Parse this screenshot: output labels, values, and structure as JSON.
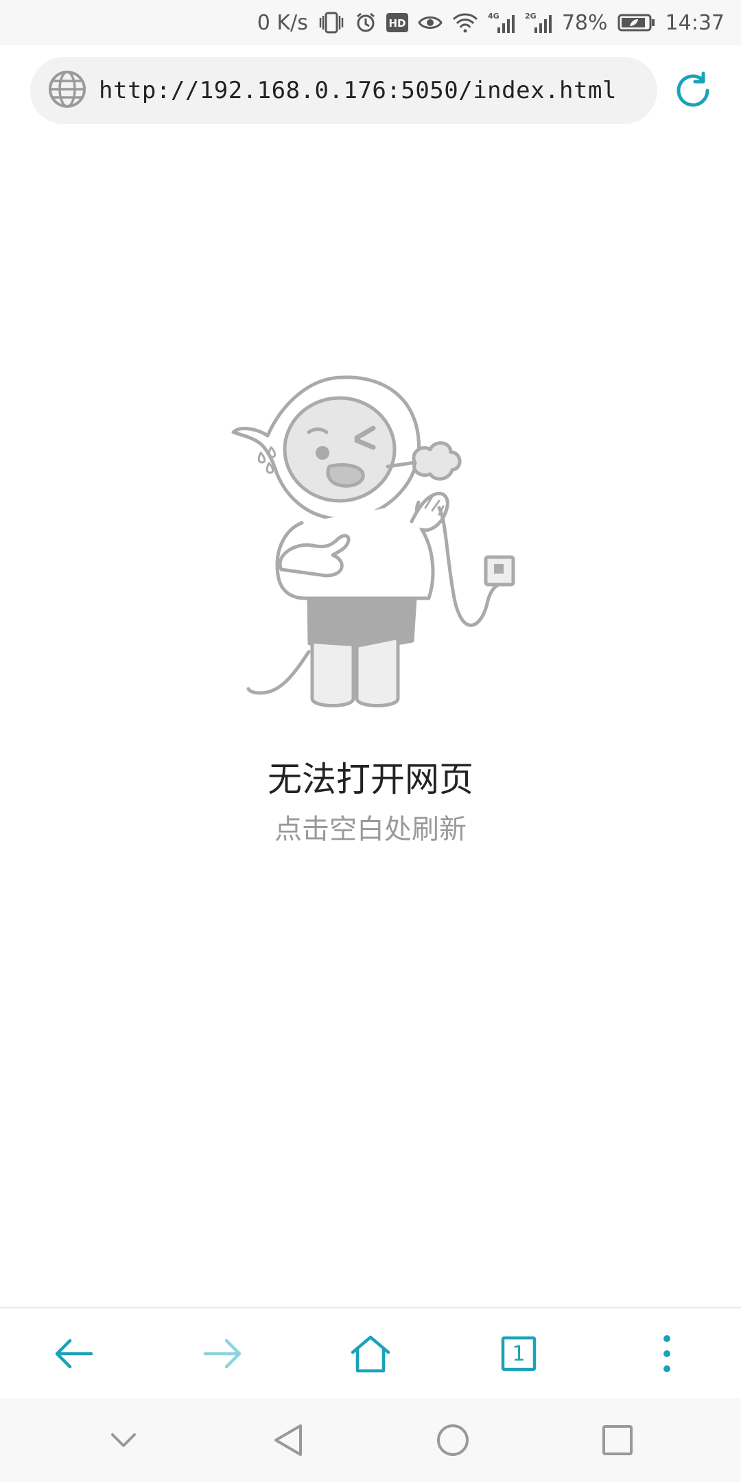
{
  "status_bar": {
    "net_speed": "0 K/s",
    "network_4g": "4G",
    "network_2g": "2G",
    "battery_percent": "78%",
    "time": "14:37",
    "icons": [
      "vibrate-icon",
      "alarm-icon",
      "hd-icon",
      "eye-comfort-icon",
      "wifi-icon",
      "signal-4g-icon",
      "signal-2g-icon",
      "battery-icon"
    ]
  },
  "address_bar": {
    "url": "http://192.168.0.176:5050/index.html",
    "globe_icon": "globe-icon",
    "refresh_icon": "refresh-icon"
  },
  "error_page": {
    "title": "无法打开网页",
    "hint": "点击空白处刷新",
    "illustration": "unplugged-character-illustration"
  },
  "toolbar": {
    "back_icon": "arrow-left-icon",
    "forward_icon": "arrow-right-icon",
    "home_icon": "home-icon",
    "tabs_count": "1",
    "menu_icon": "more-vertical-icon"
  },
  "system_nav": {
    "icons": [
      "chevron-down-icon",
      "back-triangle-icon",
      "home-circle-icon",
      "recents-square-icon"
    ]
  },
  "colors": {
    "accent": "#1aa3b8",
    "accent_disabled": "#8fd3dd",
    "text_primary": "#222222",
    "text_secondary": "#9a9a9a"
  }
}
